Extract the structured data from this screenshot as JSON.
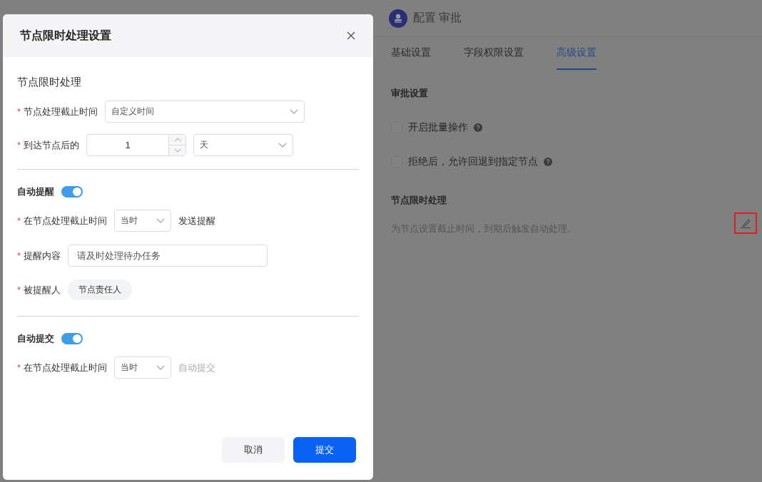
{
  "page": {
    "title": "配置 审批",
    "tabs": [
      {
        "label": "基础设置",
        "selected": false
      },
      {
        "label": "字段权限设置",
        "selected": false
      },
      {
        "label": "高级设置",
        "selected": true
      }
    ],
    "approval_settings": {
      "heading": "审批设置",
      "options": [
        {
          "label": "开启批量操作",
          "checked": false
        },
        {
          "label": "拒绝后，允许回退到指定节点",
          "checked": false
        }
      ]
    },
    "time_limit": {
      "heading": "节点限时处理",
      "description": "为节点设置截止时间，到期后触发自动处理。",
      "highlighted": true
    }
  },
  "dialog": {
    "title": "节点限时处理设置",
    "section_title": "节点限时处理",
    "deadline": {
      "required_mark": "*",
      "label": "节点处理截止时间",
      "value": "自定义时间"
    },
    "after_arrival": {
      "required_mark": "*",
      "label": "到达节点后的",
      "value": "1",
      "unit": "天"
    },
    "auto_remind": {
      "label": "自动提醒",
      "on": true,
      "time": {
        "required_mark": "*",
        "label": "在节点处理截止时间",
        "value": "当时",
        "suffix": "发送提醒",
        "suffix_muted": false
      },
      "content": {
        "required_mark": "*",
        "label": "提醒内容",
        "value": "请及时处理待办任务"
      },
      "recipients": {
        "required_mark": "*",
        "label": "被提醒人",
        "tags": [
          "节点责任人"
        ]
      }
    },
    "auto_submit": {
      "label": "自动提交",
      "on": true,
      "time": {
        "required_mark": "*",
        "label": "在节点处理截止时间",
        "value": "当时",
        "suffix": "自动提交",
        "suffix_muted": true
      }
    },
    "buttons": {
      "cancel": "取消",
      "submit": "提交"
    }
  }
}
